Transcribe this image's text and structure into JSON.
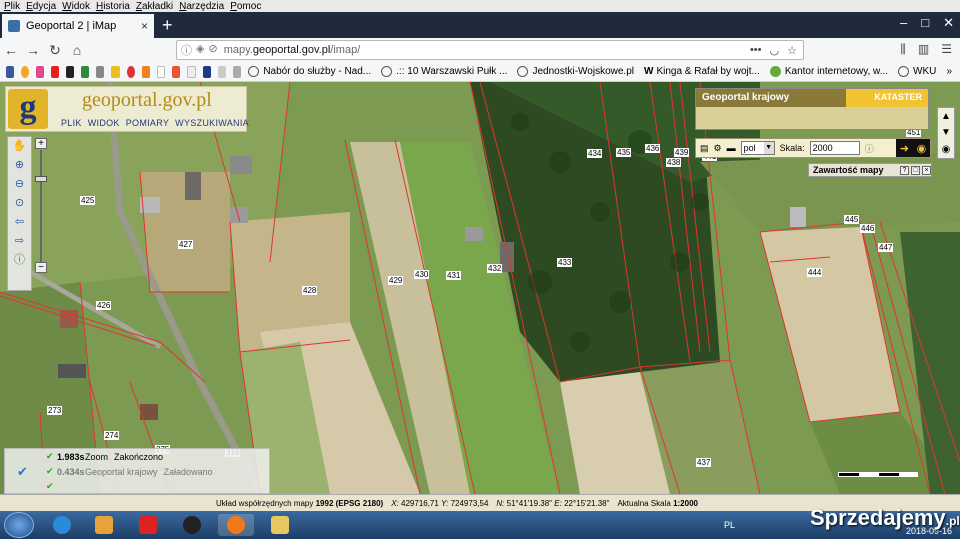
{
  "menubar": [
    "Plik",
    "Edycja",
    "Widok",
    "Historia",
    "Zakładki",
    "Narzędzia",
    "Pomoc"
  ],
  "tab": {
    "title": "Geoportal 2 | iMap",
    "close": "×"
  },
  "newtab": "+",
  "url": {
    "prefix": "mapy.",
    "host": "geoportal.gov.pl",
    "path": "/imap/"
  },
  "bookmarks": [
    "Nabór do służby - Nad...",
    ".:: 10 Warszawski Pułk ...",
    "Jednostki-Wojskowe.pl",
    "Kinga & Rafał by wojt...",
    "Kantor internetowy, w...",
    "WKU"
  ],
  "logo": {
    "letter": "g",
    "title": "geoportal.gov.pl",
    "menu": [
      "PLIK",
      "WIDOK",
      "POMIARY",
      "WYSZUKIWANIA"
    ]
  },
  "krajowy": {
    "title": "Geoportal krajowy",
    "kataster": "KATASTER"
  },
  "scale_toolbar": {
    "lang": "pol",
    "scale_label": "Skala:",
    "scale_value": "2000"
  },
  "zawartosc": {
    "title": "Zawartość mapy"
  },
  "parcels": [
    "425",
    "427",
    "428",
    "426",
    "429",
    "430",
    "431",
    "432",
    "433",
    "434",
    "435",
    "436",
    "438",
    "439",
    "441",
    "444",
    "445",
    "446",
    "447",
    "451",
    "437",
    "273",
    "274",
    "275",
    "316"
  ],
  "log": [
    {
      "time": "1.983s",
      "label": "Zoom",
      "status": "Zakończono"
    },
    {
      "time": "0.434s",
      "label": "Geoportal krajowy",
      "status": "Załadowano"
    }
  ],
  "status": {
    "system": "Układ współrzędnych mapy",
    "epsg": "1992 (EPSG 2180)",
    "x_label": "X:",
    "x": "429716,71",
    "y_label": "Y:",
    "y": "724973,54",
    "n_label": "N:",
    "n": "51°41'19.38\"",
    "e_label": "E:",
    "e": "22°15'21.38\"",
    "scale_label": "Aktualna Skala",
    "scale": "1:2000"
  },
  "taskbar": {
    "lang": "PL",
    "date": "2018-09-16"
  },
  "watermark": {
    "text": "Sprzedajemy",
    "suffix": ".pl"
  }
}
